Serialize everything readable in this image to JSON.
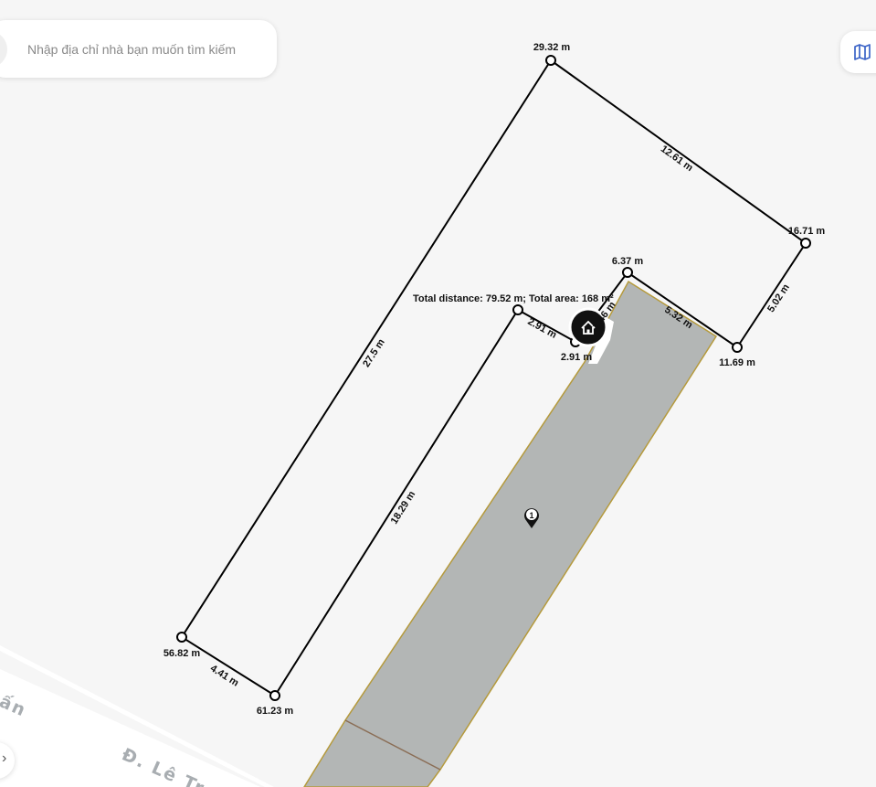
{
  "search": {
    "placeholder": "Nhập địa chỉ nhà bạn muốn tìm kiếm"
  },
  "controls": {
    "map_toggle_icon": "map-icon",
    "corner_button_icon": "chevron-icon"
  },
  "summary": {
    "text": "Total distance: 79.52 m; Total area: 168 m²"
  },
  "points": {
    "p_top": "29.32 m",
    "p_right_top": "16.71 m",
    "p_inner_top": "6.37 m",
    "p_right_bottom": "11.69 m",
    "p_inner_left": "2.91 m",
    "p_bottom_left": "56.82 m",
    "p_bottom": "61.23 m"
  },
  "segments": {
    "s_top_right": "12.61 m",
    "s_right": "5.02 m",
    "s_inner_right": "5.32 m",
    "s_inner_short": "3.46 m",
    "s_inner_top": "2.91 m",
    "s_long_left": "27.5 m",
    "s_long_inner": "18.29 m",
    "s_bottom": "4.41 m"
  },
  "parcel": {
    "marker_number": "1",
    "fill_color": "#b3b6b5",
    "border_color": "#b59a3c"
  },
  "roads": {
    "road_left_partial": "ấn",
    "road_bottom": "Đ. Lê Tr"
  },
  "colors": {
    "measure_line": "#000000",
    "background": "#f6f6f6",
    "road": "#ffffff"
  }
}
